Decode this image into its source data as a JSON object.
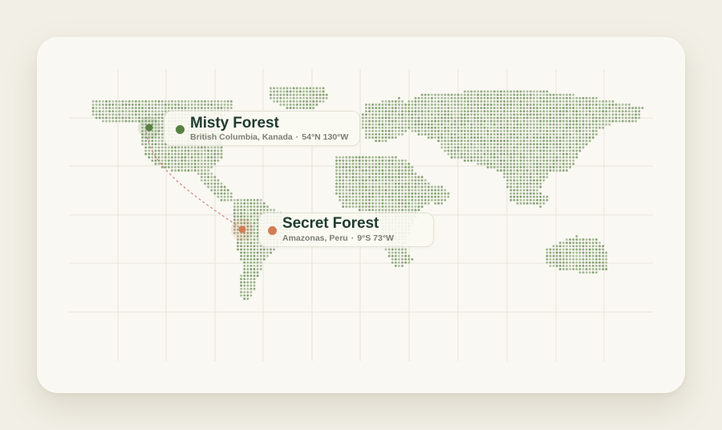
{
  "colors": {
    "page_bg": "#f2efe6",
    "card_bg": "#faf8f2",
    "land_dot": "#7a9a6a",
    "grid_line": "#e6e5da",
    "misty_accent": "#56813f",
    "secret_accent": "#d37c55",
    "route_line": "#d9898b",
    "title_text": "#1f3b30",
    "sub_text": "#7c7f73"
  },
  "map": {
    "style": "dotted-world-map",
    "grid": true
  },
  "markers": [
    {
      "id": "misty",
      "title": "Misty Forest",
      "region": "British Columbia, Kanada",
      "separator": "·",
      "coords": "54°N 130°W",
      "color": "#56813f"
    },
    {
      "id": "secret",
      "title": "Secret Forest",
      "region": "Amazonas, Peru",
      "separator": "·",
      "coords": "9°S 73°W",
      "color": "#d37c55"
    }
  ],
  "route": {
    "from": "misty",
    "to": "secret",
    "style": "dashed"
  }
}
